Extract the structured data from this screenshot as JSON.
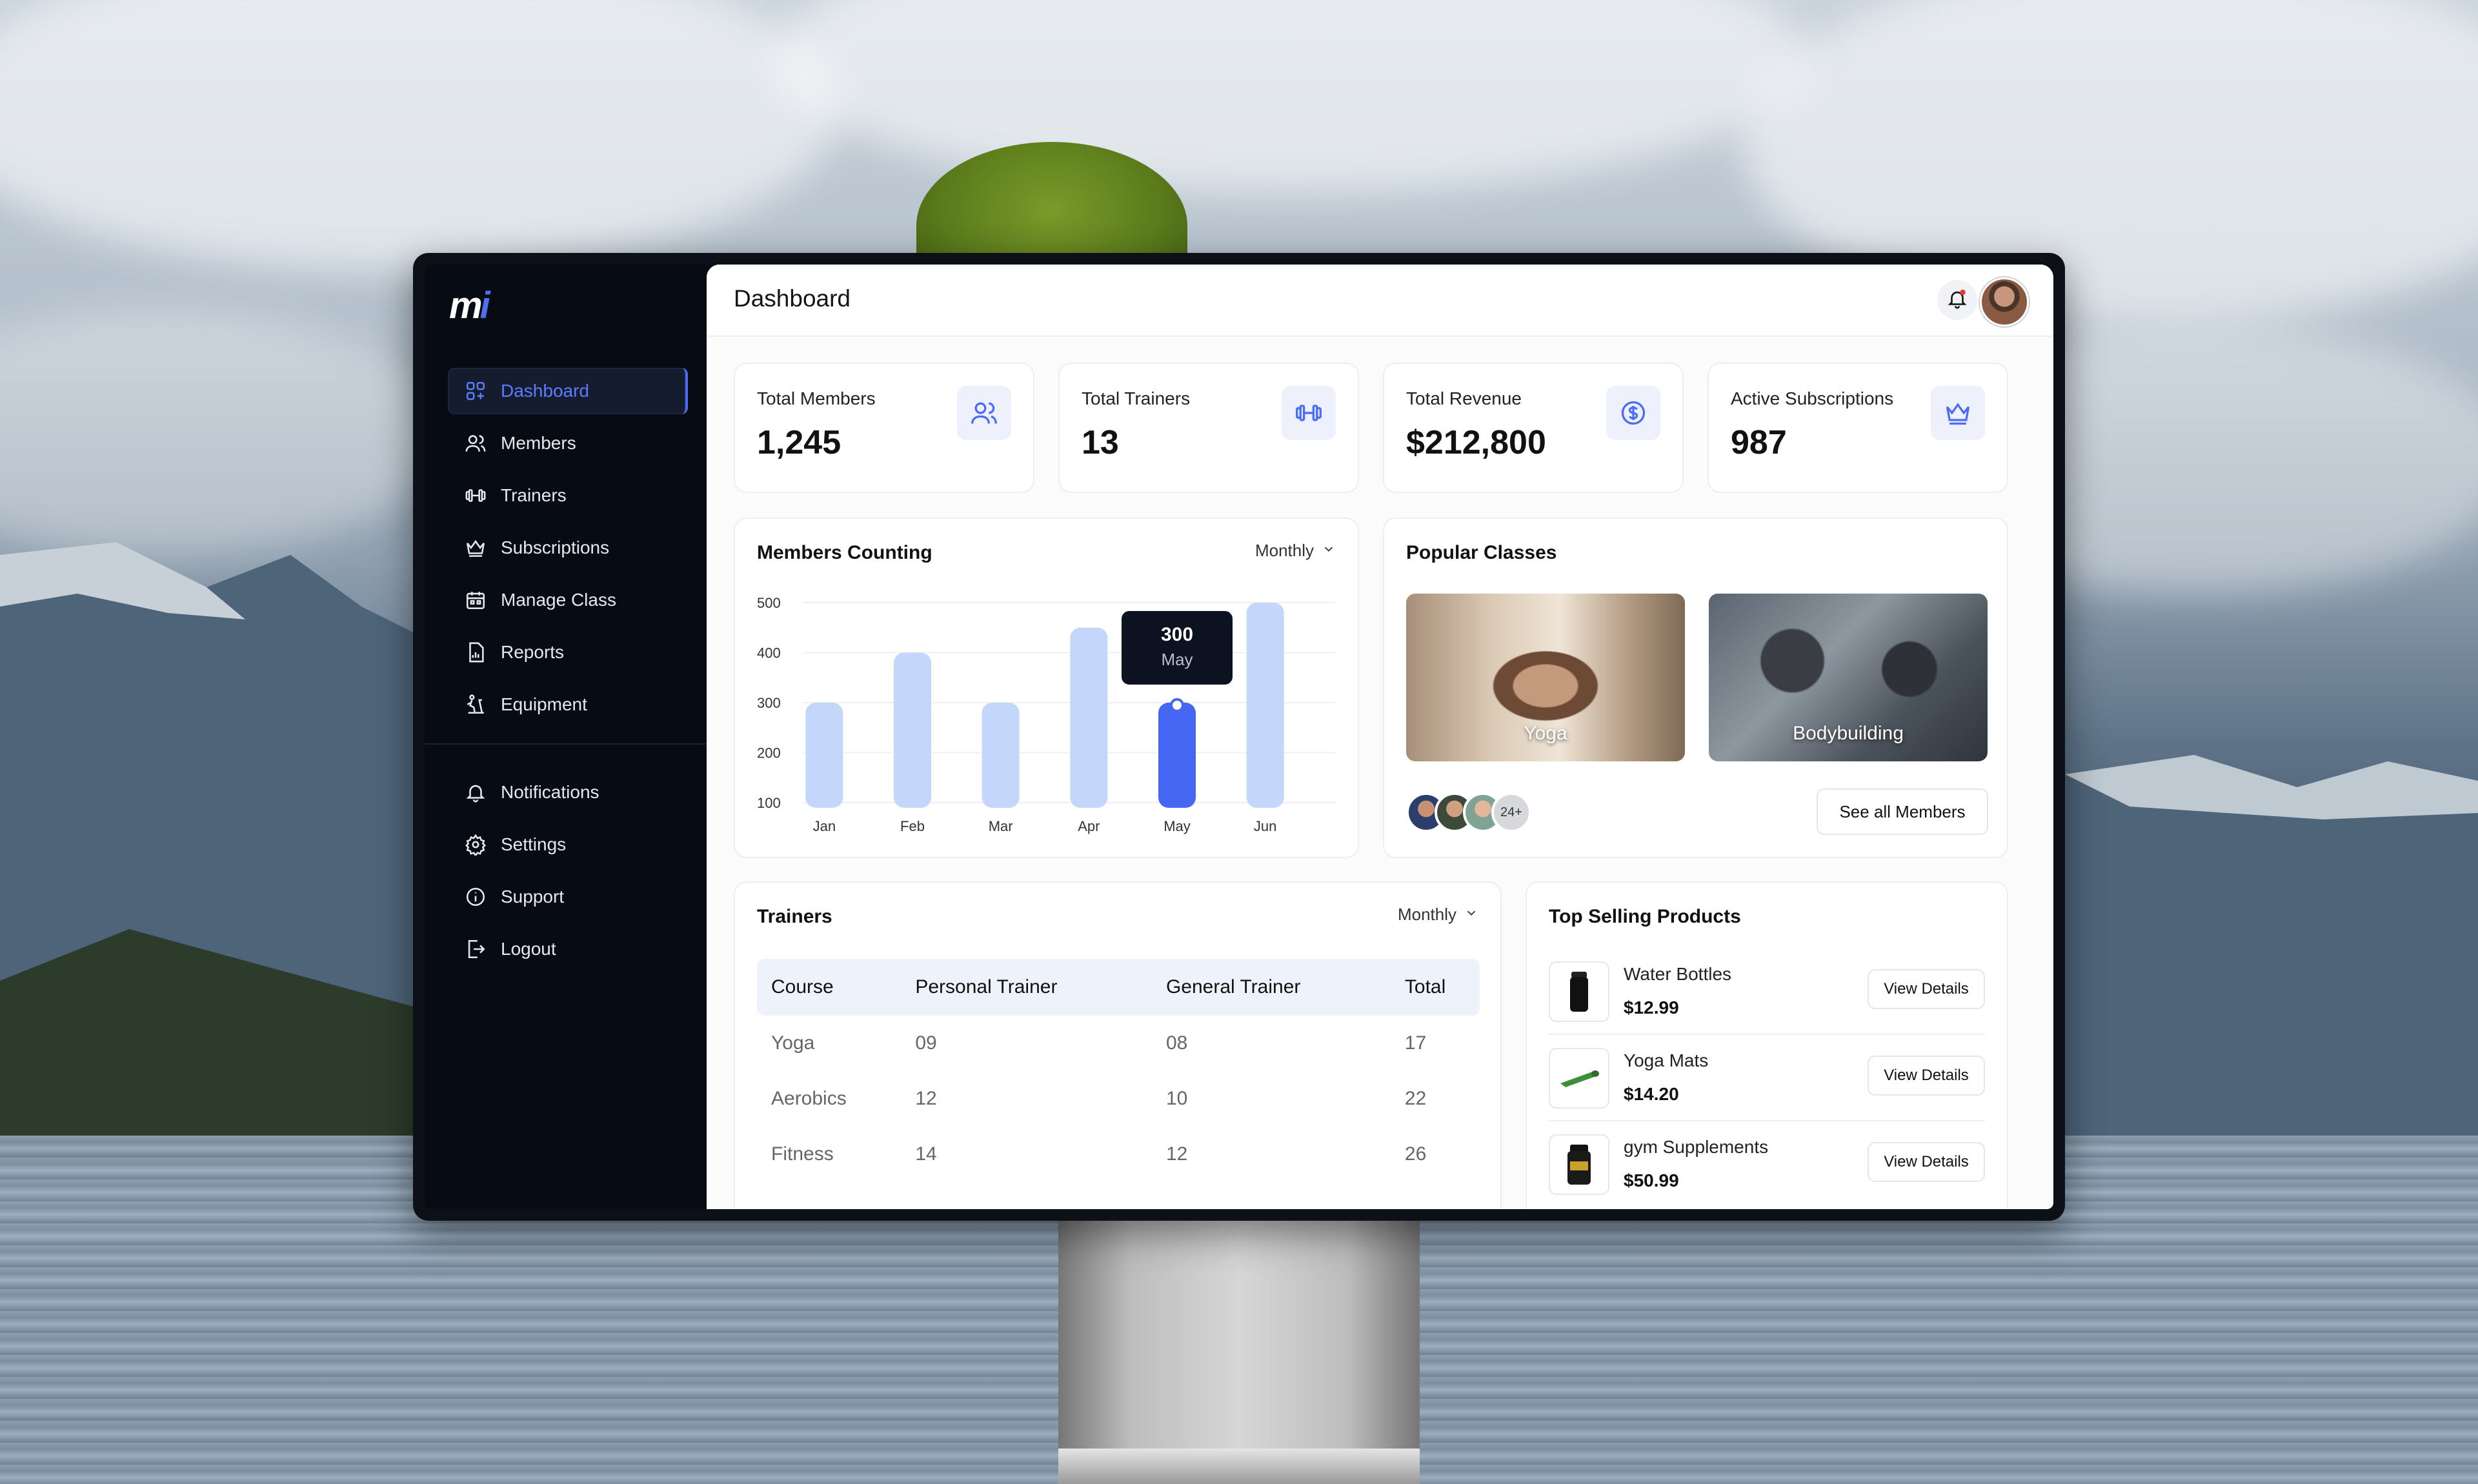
{
  "app": {
    "logo_text": "m",
    "logo_dot": "i",
    "page_title": "Dashboard",
    "accent": "#4a6cf7"
  },
  "sidebar": {
    "items": [
      {
        "label": "Dashboard",
        "icon": "dashboard-icon",
        "active": true
      },
      {
        "label": "Members",
        "icon": "members-icon"
      },
      {
        "label": "Trainers",
        "icon": "dumbbell-icon"
      },
      {
        "label": "Subscriptions",
        "icon": "crown-icon"
      },
      {
        "label": "Manage Class",
        "icon": "calendar-icon"
      },
      {
        "label": "Reports",
        "icon": "report-icon"
      },
      {
        "label": "Equipment",
        "icon": "treadmill-icon"
      }
    ],
    "secondary": [
      {
        "label": "Notifications",
        "icon": "bell-icon"
      },
      {
        "label": "Settings",
        "icon": "gear-icon"
      },
      {
        "label": "Support",
        "icon": "info-icon"
      },
      {
        "label": "Logout",
        "icon": "logout-icon"
      }
    ]
  },
  "stats": [
    {
      "label": "Total Members",
      "value": "1,245",
      "icon": "members-icon"
    },
    {
      "label": "Total Trainers",
      "value": "13",
      "icon": "dumbbell-icon"
    },
    {
      "label": "Total Revenue",
      "value": "$212,800",
      "icon": "dollar-icon"
    },
    {
      "label": "Active Subscriptions",
      "value": "987",
      "icon": "crown-icon"
    }
  ],
  "members_chart": {
    "title": "Members Counting",
    "period": "Monthly",
    "tooltip": {
      "value": "300",
      "label": "May"
    }
  },
  "chart_data": {
    "type": "bar",
    "title": "Members Counting",
    "categories": [
      "Jan",
      "Feb",
      "Mar",
      "Apr",
      "May",
      "Jun"
    ],
    "values": [
      300,
      400,
      300,
      450,
      300,
      500
    ],
    "highlight_index": 4,
    "yticks": [
      100,
      200,
      300,
      400,
      500
    ],
    "ylim": [
      100,
      500
    ],
    "xlabel": "",
    "ylabel": "",
    "bar_color": "#c5d6fb",
    "highlight_color": "#4466f2",
    "grid": true
  },
  "popular_classes": {
    "title": "Popular Classes",
    "classes": [
      {
        "label": "Yoga"
      },
      {
        "label": "Bodybuilding"
      }
    ],
    "member_count": "24+",
    "see_all_label": "See all Members"
  },
  "trainers": {
    "title": "Trainers",
    "period": "Monthly",
    "columns": [
      "Course",
      "Personal Trainer",
      "General Trainer",
      "Total"
    ],
    "rows": [
      [
        "Yoga",
        "09",
        "08",
        "17"
      ],
      [
        "Aerobics",
        "12",
        "10",
        "22"
      ],
      [
        "Fitness",
        "14",
        "12",
        "26"
      ]
    ]
  },
  "products": {
    "title": "Top Selling Products",
    "button_label": "View Details",
    "items": [
      {
        "name": "Water Bottles",
        "price": "$12.99",
        "icon": "bottle-icon"
      },
      {
        "name": "Yoga Mats",
        "price": "$14.20",
        "icon": "yoga-mat-icon"
      },
      {
        "name": "gym Supplements",
        "price": "$50.99",
        "icon": "supplement-jar-icon"
      }
    ]
  }
}
